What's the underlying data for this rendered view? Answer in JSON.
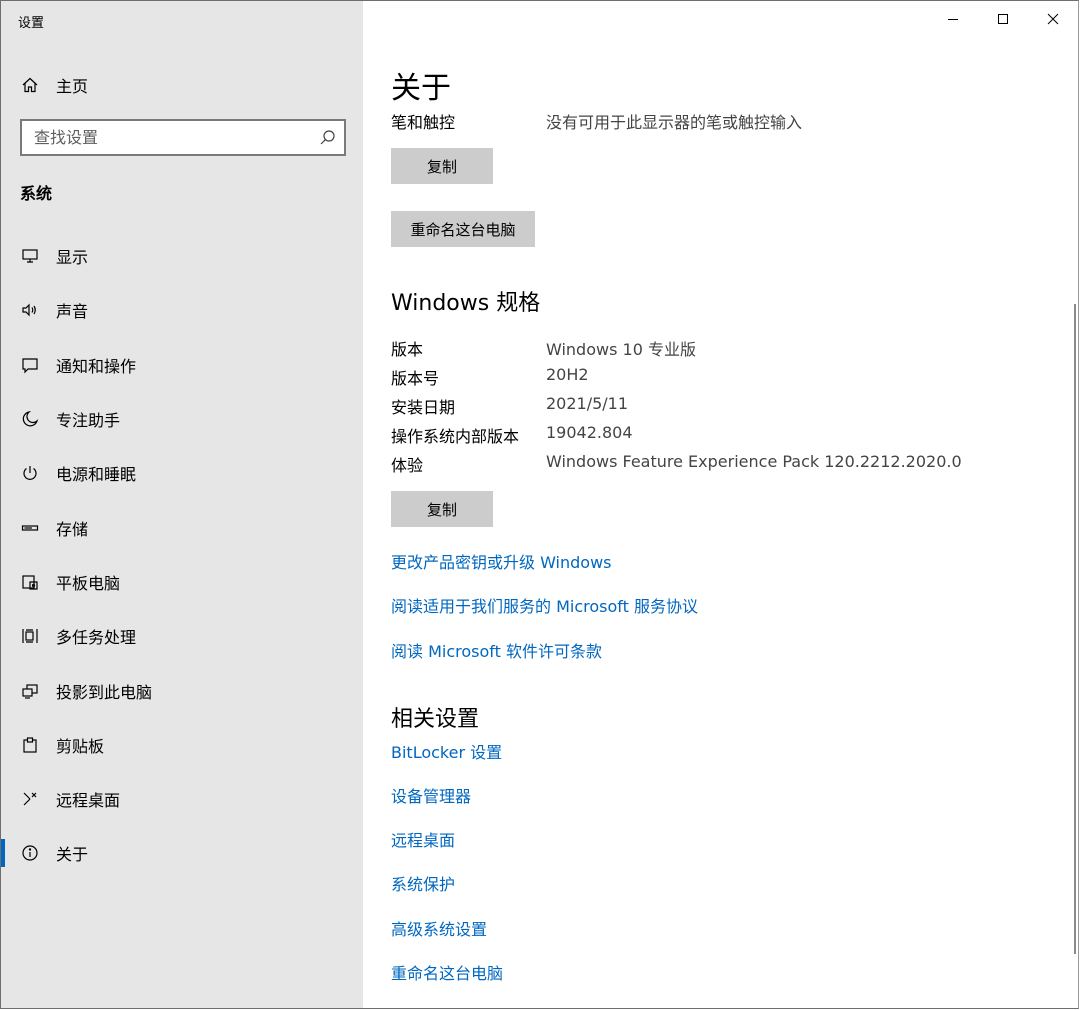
{
  "window": {
    "title": "设置"
  },
  "sidebar": {
    "home_label": "主页",
    "home_icon": "home-icon",
    "search_placeholder": "查找设置",
    "search_icon": "search-icon",
    "section_label": "系统",
    "accent_color": "#0067c0",
    "items": [
      {
        "label": "显示",
        "icon": "monitor-icon"
      },
      {
        "label": "声音",
        "icon": "speaker-icon"
      },
      {
        "label": "通知和操作",
        "icon": "notification-icon"
      },
      {
        "label": "专注助手",
        "icon": "moon-icon"
      },
      {
        "label": "电源和睡眠",
        "icon": "power-icon"
      },
      {
        "label": "存储",
        "icon": "storage-icon"
      },
      {
        "label": "平板电脑",
        "icon": "tablet-icon"
      },
      {
        "label": "多任务处理",
        "icon": "multitask-icon"
      },
      {
        "label": "投影到此电脑",
        "icon": "project-icon"
      },
      {
        "label": "剪贴板",
        "icon": "clipboard-icon"
      },
      {
        "label": "远程桌面",
        "icon": "remote-desktop-icon"
      },
      {
        "label": "关于",
        "icon": "info-icon",
        "selected": true
      }
    ]
  },
  "main": {
    "title": "关于",
    "pen_touch": {
      "key": "笔和触控",
      "value": "没有可用于此显示器的笔或触控输入"
    },
    "copy_label": "复制",
    "rename_label": "重命名这台电脑",
    "windows_spec": {
      "title": "Windows 规格",
      "rows": [
        {
          "key": "版本",
          "value": "Windows 10 专业版"
        },
        {
          "key": "版本号",
          "value": "20H2"
        },
        {
          "key": "安装日期",
          "value": "2021/5/11"
        },
        {
          "key": "操作系统内部版本",
          "value": "19042.804"
        },
        {
          "key": "体验",
          "value": "Windows Feature Experience Pack 120.2212.2020.0"
        }
      ],
      "copy_label": "复制"
    },
    "links": [
      "更改产品密钥或升级 Windows",
      "阅读适用于我们服务的 Microsoft 服务协议",
      "阅读 Microsoft 软件许可条款"
    ],
    "related": {
      "title": "相关设置",
      "links": [
        "BitLocker 设置",
        "设备管理器",
        "远程桌面",
        "系统保护",
        "高级系统设置",
        "重命名这台电脑"
      ]
    }
  },
  "window_controls": {
    "minimize_icon": "minimize-icon",
    "maximize_icon": "maximize-icon",
    "close_icon": "close-icon"
  }
}
